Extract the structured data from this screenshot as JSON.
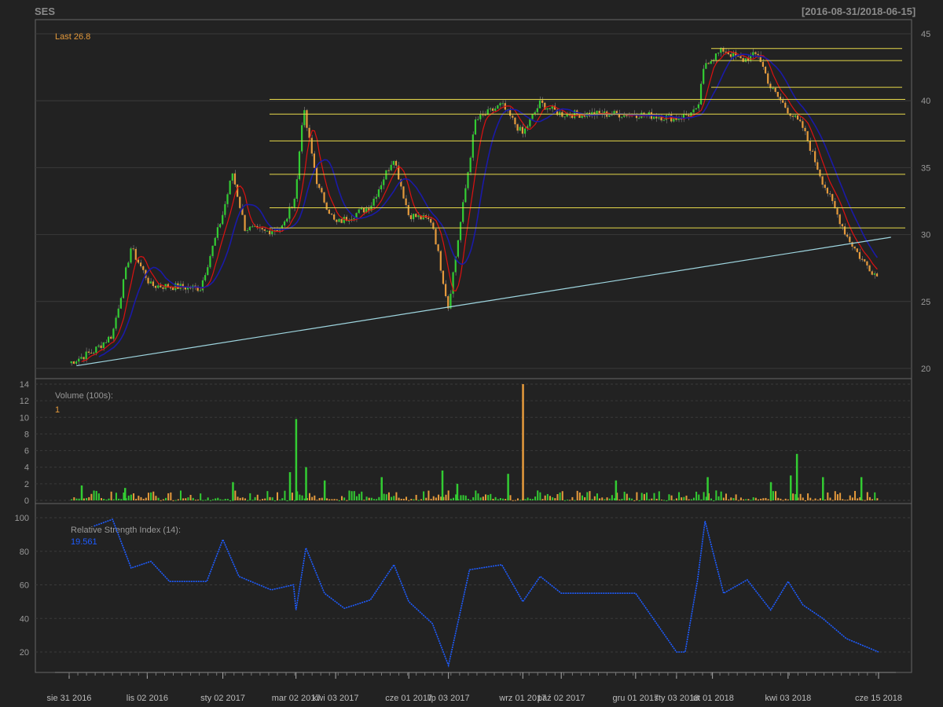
{
  "header": {
    "symbol": "SES",
    "range": "[2016-08-31/2018-06-15]"
  },
  "colors": {
    "background": "#222222",
    "up": "#33cc33",
    "down": "#e59a3c",
    "ma_fast": "#dd1111",
    "ma_slow": "#1a1aa8",
    "sr_lines": "#e6d84a",
    "trend": "#9fd6e0",
    "rsi": "#1e5cff",
    "axis_text": "#999999",
    "grid": "#3a3a3a"
  },
  "chart_data": [
    {
      "type": "candlestick",
      "panel": "price",
      "annotation": "Last 26.8",
      "ylim": [
        20,
        45
      ],
      "y_ticks": [
        20,
        25,
        30,
        35,
        40,
        45
      ],
      "grid": true,
      "x_tick_labels": [
        "sie 31 2016",
        "lis 02 2016",
        "sty 02 2017",
        "mar 02 2017",
        "kwi 03 2017",
        "cze 01 2017",
        "lip 03 2017",
        "wrz 01 2017",
        "paź 02 2017",
        "gru 01 2017",
        "sty 03 2018",
        "lut 01 2018",
        "kwi 03 2018",
        "cze 15 2018"
      ],
      "x_tick_dates": [
        "2016-08-31",
        "2016-11-02",
        "2017-01-02",
        "2017-03-02",
        "2017-04-03",
        "2017-06-01",
        "2017-07-03",
        "2017-09-01",
        "2017-10-02",
        "2017-12-01",
        "2018-01-03",
        "2018-02-01",
        "2018-04-03",
        "2018-06-15"
      ],
      "close_points": [
        [
          "2016-08-31",
          20.4
        ],
        [
          "2016-09-20",
          21.3
        ],
        [
          "2016-10-05",
          22.5
        ],
        [
          "2016-10-20",
          29.0
        ],
        [
          "2016-11-05",
          26.2
        ],
        [
          "2016-12-15",
          26.0
        ],
        [
          "2017-01-02",
          31.5
        ],
        [
          "2017-01-10",
          34.6
        ],
        [
          "2017-01-20",
          30.5
        ],
        [
          "2017-02-05",
          30.2
        ],
        [
          "2017-02-20",
          30.6
        ],
        [
          "2017-03-02",
          33.0
        ],
        [
          "2017-03-08",
          39.5
        ],
        [
          "2017-03-20",
          33.5
        ],
        [
          "2017-04-03",
          30.8
        ],
        [
          "2017-05-01",
          32.1
        ],
        [
          "2017-05-20",
          35.8
        ],
        [
          "2017-06-01",
          31.5
        ],
        [
          "2017-06-20",
          31.0
        ],
        [
          "2017-07-03",
          24.6
        ],
        [
          "2017-07-25",
          38.5
        ],
        [
          "2017-08-15",
          39.7
        ],
        [
          "2017-09-01",
          37.5
        ],
        [
          "2017-09-15",
          39.8
        ],
        [
          "2017-10-02",
          39.0
        ],
        [
          "2017-12-01",
          39.0
        ],
        [
          "2018-01-03",
          38.7
        ],
        [
          "2018-01-20",
          39.2
        ],
        [
          "2018-01-26",
          42.8
        ],
        [
          "2018-02-10",
          43.8
        ],
        [
          "2018-02-25",
          43.0
        ],
        [
          "2018-03-10",
          43.5
        ],
        [
          "2018-03-20",
          41.0
        ],
        [
          "2018-04-03",
          39.3
        ],
        [
          "2018-04-15",
          38.0
        ],
        [
          "2018-05-01",
          34.0
        ],
        [
          "2018-05-20",
          30.0
        ],
        [
          "2018-06-01",
          28.2
        ],
        [
          "2018-06-15",
          26.8
        ]
      ],
      "support_resistance": [
        40.1,
        39.0,
        37.0,
        34.5,
        32.0,
        30.5
      ],
      "other_sr": [
        43.0,
        43.9,
        41.0
      ],
      "trendline": {
        "from": [
          "2016-09-06",
          20.2
        ],
        "to": [
          "2018-06-25",
          29.8
        ]
      }
    },
    {
      "type": "bar",
      "panel": "volume",
      "title": "Volume (100s):",
      "last_value": "1",
      "ylim": [
        0,
        14
      ],
      "y_ticks": [
        0,
        2,
        4,
        6,
        8,
        10,
        12,
        14
      ],
      "spikes": [
        [
          "2016-09-10",
          1.8
        ],
        [
          "2016-10-15",
          1.5
        ],
        [
          "2017-01-10",
          2.2
        ],
        [
          "2017-02-25",
          3.4
        ],
        [
          "2017-03-02",
          9.8
        ],
        [
          "2017-03-10",
          4.0
        ],
        [
          "2017-03-25",
          2.4
        ],
        [
          "2017-05-10",
          2.8
        ],
        [
          "2017-06-28",
          3.6
        ],
        [
          "2017-07-10",
          2.0
        ],
        [
          "2017-08-20",
          3.2
        ],
        [
          "2017-09-01",
          14.0
        ],
        [
          "2017-11-15",
          2.4
        ],
        [
          "2018-01-28",
          2.8
        ],
        [
          "2018-03-20",
          2.2
        ],
        [
          "2018-04-10",
          5.6
        ],
        [
          "2018-04-05",
          3.0
        ],
        [
          "2018-05-01",
          2.8
        ],
        [
          "2018-06-01",
          2.8
        ]
      ]
    },
    {
      "type": "line",
      "panel": "rsi",
      "title": "Relative Strength Index (14):",
      "last_value": "19.561",
      "ylim": [
        10,
        100
      ],
      "y_ticks": [
        20,
        40,
        60,
        80,
        100
      ],
      "points": [
        [
          "2016-09-20",
          95
        ],
        [
          "2016-10-05",
          99
        ],
        [
          "2016-10-20",
          70
        ],
        [
          "2016-11-05",
          74
        ],
        [
          "2016-11-20",
          62
        ],
        [
          "2016-12-20",
          62
        ],
        [
          "2017-01-02",
          87
        ],
        [
          "2017-01-15",
          65
        ],
        [
          "2017-02-10",
          57
        ],
        [
          "2017-02-28",
          60
        ],
        [
          "2017-03-02",
          45
        ],
        [
          "2017-03-10",
          82
        ],
        [
          "2017-03-25",
          55
        ],
        [
          "2017-04-10",
          46
        ],
        [
          "2017-05-01",
          51
        ],
        [
          "2017-05-20",
          72
        ],
        [
          "2017-06-01",
          50
        ],
        [
          "2017-06-20",
          37
        ],
        [
          "2017-07-03",
          12
        ],
        [
          "2017-07-20",
          69
        ],
        [
          "2017-08-15",
          72
        ],
        [
          "2017-09-01",
          50
        ],
        [
          "2017-09-15",
          65
        ],
        [
          "2017-10-02",
          55
        ],
        [
          "2017-12-01",
          55
        ],
        [
          "2018-01-03",
          20
        ],
        [
          "2018-01-10",
          20
        ],
        [
          "2018-01-20",
          63
        ],
        [
          "2018-01-26",
          98
        ],
        [
          "2018-02-10",
          55
        ],
        [
          "2018-03-01",
          63
        ],
        [
          "2018-03-20",
          45
        ],
        [
          "2018-04-03",
          62
        ],
        [
          "2018-04-15",
          48
        ],
        [
          "2018-05-01",
          40
        ],
        [
          "2018-05-20",
          28
        ],
        [
          "2018-06-15",
          20
        ]
      ]
    }
  ]
}
